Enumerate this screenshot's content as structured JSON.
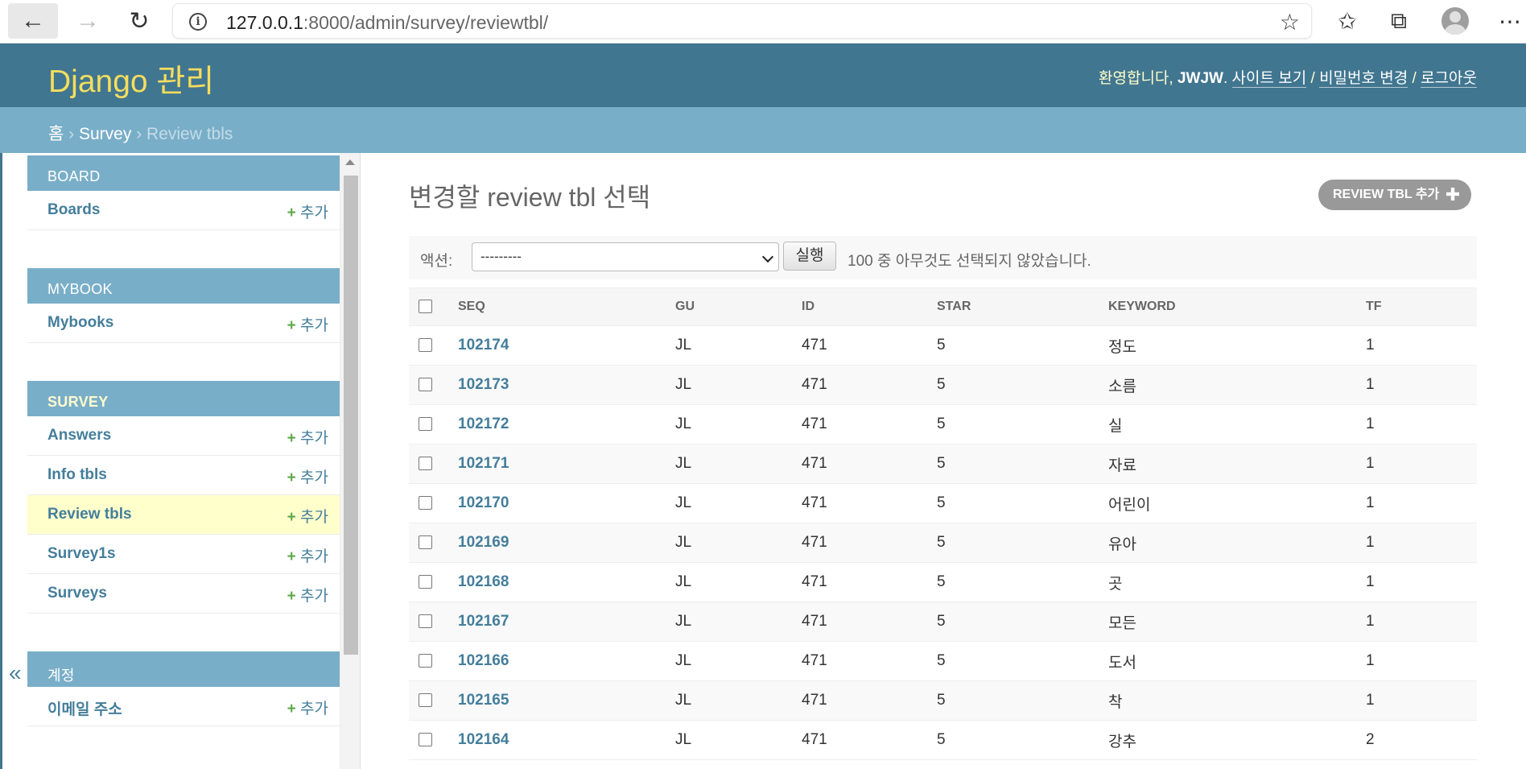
{
  "browser": {
    "url_host": "127.0.0.1",
    "url_rest": ":8000/admin/survey/reviewtbl/"
  },
  "header": {
    "branding": "Django 관리",
    "welcome": "환영합니다, ",
    "username": "JWJW",
    "view_site": "사이트 보기",
    "change_password": "비밀번호 변경",
    "logout": "로그아웃",
    "separator": " / "
  },
  "breadcrumbs": {
    "home": "홈",
    "app": "Survey",
    "current": "Review tbls",
    "sep": " › "
  },
  "sidebar": {
    "toggle": "«",
    "add_label": "추가",
    "modules": [
      {
        "caption": "BOARD",
        "models": [
          {
            "name": "Boards"
          }
        ]
      },
      {
        "caption": "MYBOOK",
        "models": [
          {
            "name": "Mybooks"
          }
        ]
      },
      {
        "caption": "SURVEY",
        "models": [
          {
            "name": "Answers"
          },
          {
            "name": "Info tbls"
          },
          {
            "name": "Review tbls"
          },
          {
            "name": "Survey1s"
          },
          {
            "name": "Surveys"
          }
        ]
      },
      {
        "caption": "계정",
        "models": [
          {
            "name": "이메일 주소"
          }
        ]
      }
    ]
  },
  "main": {
    "title": "변경할 review tbl 선택",
    "add_button": "REVIEW TBL 추가",
    "actions": {
      "label": "액션:",
      "selected": "---------",
      "go": "실행",
      "counter": "100 중 아무것도 선택되지 않았습니다."
    },
    "columns": [
      "SEQ",
      "GU",
      "ID",
      "STAR",
      "KEYWORD",
      "TF"
    ],
    "rows": [
      {
        "seq": "102174",
        "gu": "JL",
        "id": "471",
        "star": "5",
        "keyword": "정도",
        "tf": "1"
      },
      {
        "seq": "102173",
        "gu": "JL",
        "id": "471",
        "star": "5",
        "keyword": "소름",
        "tf": "1"
      },
      {
        "seq": "102172",
        "gu": "JL",
        "id": "471",
        "star": "5",
        "keyword": "실",
        "tf": "1"
      },
      {
        "seq": "102171",
        "gu": "JL",
        "id": "471",
        "star": "5",
        "keyword": "자료",
        "tf": "1"
      },
      {
        "seq": "102170",
        "gu": "JL",
        "id": "471",
        "star": "5",
        "keyword": "어린이",
        "tf": "1"
      },
      {
        "seq": "102169",
        "gu": "JL",
        "id": "471",
        "star": "5",
        "keyword": "유아",
        "tf": "1"
      },
      {
        "seq": "102168",
        "gu": "JL",
        "id": "471",
        "star": "5",
        "keyword": "곳",
        "tf": "1"
      },
      {
        "seq": "102167",
        "gu": "JL",
        "id": "471",
        "star": "5",
        "keyword": "모든",
        "tf": "1"
      },
      {
        "seq": "102166",
        "gu": "JL",
        "id": "471",
        "star": "5",
        "keyword": "도서",
        "tf": "1"
      },
      {
        "seq": "102165",
        "gu": "JL",
        "id": "471",
        "star": "5",
        "keyword": "착",
        "tf": "1"
      },
      {
        "seq": "102164",
        "gu": "JL",
        "id": "471",
        "star": "5",
        "keyword": "강추",
        "tf": "2"
      }
    ]
  },
  "colors": {
    "header": "#417690",
    "breadcrumbs": "#79aec8",
    "branding": "#f5dd5d",
    "link": "#447e9b",
    "add_plus": "#5da84a",
    "current_row": "#ffffcc"
  },
  "icons": {
    "back": "arrow-left-icon",
    "forward": "arrow-right-icon",
    "reload": "reload-icon",
    "info": "info-icon",
    "favorite_add": "star-plus-icon",
    "favorites": "favorites-icon",
    "collections": "collections-icon",
    "profile": "avatar",
    "menu": "more-icon"
  }
}
